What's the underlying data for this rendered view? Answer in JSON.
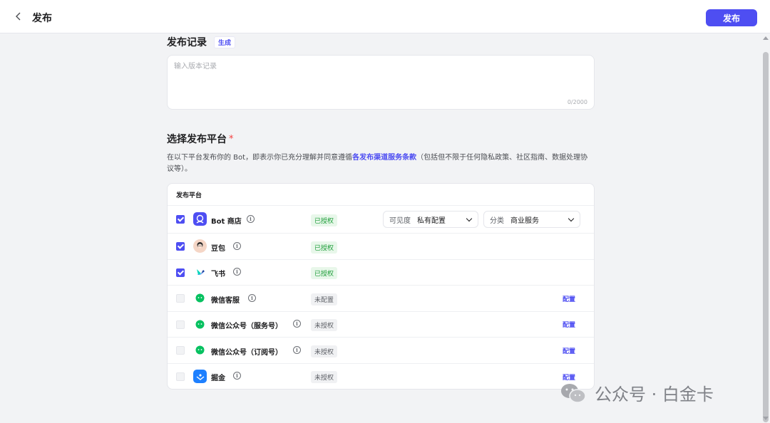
{
  "header": {
    "title": "发布",
    "publish_label": "发布"
  },
  "record": {
    "title": "发布记录",
    "generate_label": "生成",
    "placeholder": "输入版本记录",
    "value": "",
    "counter": "0/2000"
  },
  "platform_section": {
    "title": "选择发布平台",
    "required_mark": "*",
    "desc_pre": "在以下平台发布你的 Bot，即表示你已充分理解并同意遵循",
    "desc_link": "各发布渠道服务条款",
    "desc_post": "（包括但不限于任何隐私政策、社区指南、数据处理协议等）。"
  },
  "table": {
    "header": "发布平台",
    "rows": [
      {
        "name": "Bot 商店",
        "checked": true,
        "status": "已授权",
        "status_type": "auth",
        "icon": "bot-store-icon",
        "icon_color": "#4e4ef2",
        "config": ""
      },
      {
        "name": "豆包",
        "checked": true,
        "status": "已授权",
        "status_type": "auth",
        "icon": "doubao-icon",
        "icon_color": "#f5d6c6",
        "config": ""
      },
      {
        "name": "飞书",
        "checked": true,
        "status": "已授权",
        "status_type": "auth",
        "icon": "feishu-icon",
        "icon_color": "#3370ff",
        "config": ""
      },
      {
        "name": "微信客服",
        "checked": false,
        "status": "未配置",
        "status_type": "unauth",
        "icon": "wechat-icon",
        "icon_color": "#07c160",
        "config": "配置"
      },
      {
        "name": "微信公众号（服务号）",
        "checked": false,
        "status": "未授权",
        "status_type": "unauth",
        "icon": "wechat-icon",
        "icon_color": "#07c160",
        "config": "配置"
      },
      {
        "name": "微信公众号（订阅号）",
        "checked": false,
        "status": "未授权",
        "status_type": "unauth",
        "icon": "wechat-icon",
        "icon_color": "#07c160",
        "config": "配置"
      },
      {
        "name": "掘金",
        "checked": false,
        "status": "未授权",
        "status_type": "unauth",
        "icon": "juejin-icon",
        "icon_color": "#1e80ff",
        "config": "配置"
      }
    ],
    "visibility": {
      "label": "可见度",
      "value": "私有配置"
    },
    "category": {
      "label": "分类",
      "value": "商业服务"
    }
  },
  "watermark": {
    "text": "公众号 · 白金卡"
  }
}
